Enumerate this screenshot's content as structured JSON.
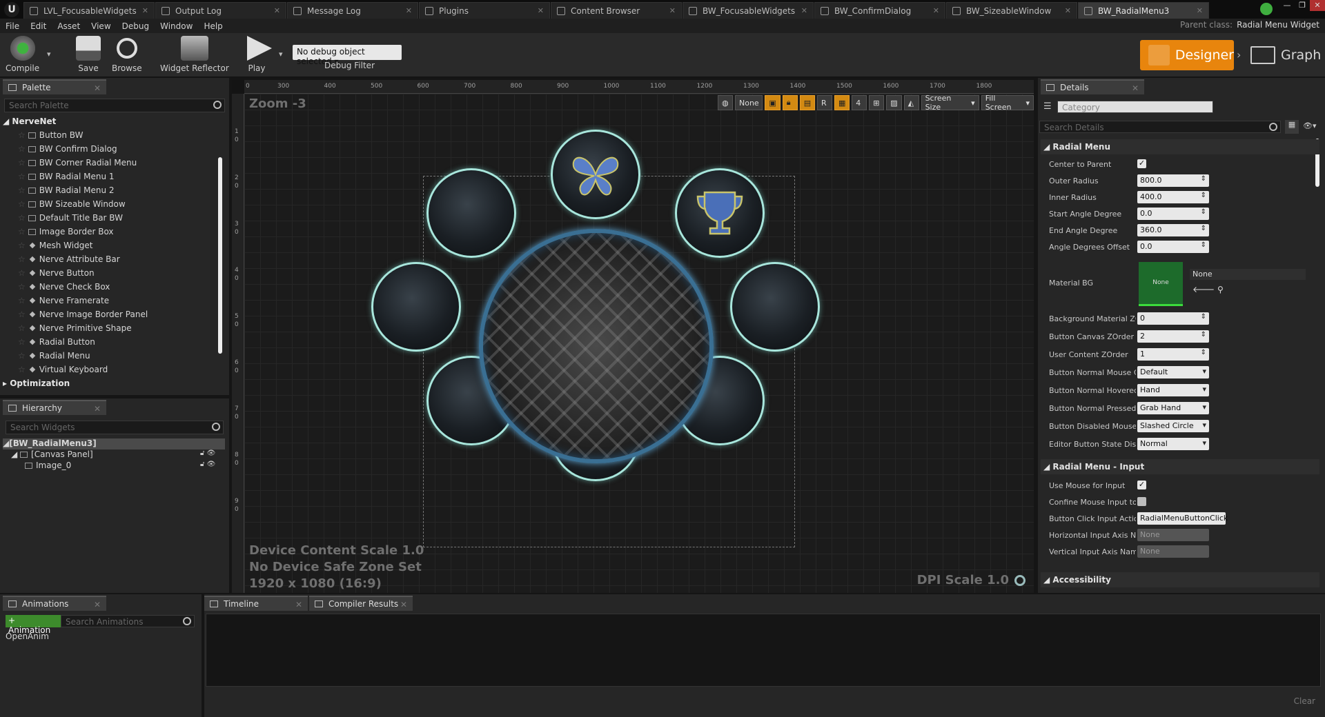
{
  "tabs": [
    {
      "label": "LVL_FocusableWidgets"
    },
    {
      "label": "Output Log"
    },
    {
      "label": "Message Log"
    },
    {
      "label": "Plugins"
    },
    {
      "label": "Content Browser"
    },
    {
      "label": "BW_FocusableWidgets"
    },
    {
      "label": "BW_ConfirmDialog"
    },
    {
      "label": "BW_SizeableWindow"
    },
    {
      "label": "BW_RadialMenu3"
    }
  ],
  "menu": [
    "File",
    "Edit",
    "Asset",
    "View",
    "Debug",
    "Window",
    "Help"
  ],
  "parent_class": {
    "label": "Parent class:",
    "value": "Radial Menu Widget"
  },
  "toolbar": {
    "compile": "Compile",
    "save": "Save",
    "browse": "Browse",
    "reflector": "Widget Reflector",
    "play": "Play",
    "debug_value": "No debug object selected",
    "debug_label": "Debug Filter",
    "designer": "Designer",
    "graph": "Graph"
  },
  "palette": {
    "title": "Palette",
    "search_placeholder": "Search Palette",
    "category": "NerveNet",
    "items": [
      "Button BW",
      "BW Confirm Dialog",
      "BW Corner Radial Menu",
      "BW Radial Menu 1",
      "BW Radial Menu 2",
      "BW Sizeable Window",
      "Default Title Bar BW",
      "Image Border Box",
      "Mesh Widget",
      "Nerve Attribute Bar",
      "Nerve Button",
      "Nerve Check Box",
      "Nerve Framerate",
      "Nerve Image Border Panel",
      "Nerve Primitive Shape",
      "Radial Button",
      "Radial Menu",
      "Virtual Keyboard"
    ],
    "category2": "Optimization"
  },
  "hierarchy": {
    "title": "Hierarchy",
    "search_placeholder": "Search Widgets",
    "root": "[BW_RadialMenu3]",
    "child": "[Canvas Panel]",
    "leaf": "Image_0"
  },
  "canvas": {
    "zoom": "Zoom -3",
    "ruler_top": [
      "0",
      "300",
      "400",
      "500",
      "600",
      "700",
      "800",
      "900",
      "1000",
      "1100",
      "1200",
      "1300",
      "1400",
      "1500",
      "1600",
      "1700",
      "1800"
    ],
    "ruler_left": [
      "1",
      "2",
      "3",
      "4",
      "5",
      "6",
      "7",
      "8",
      "9"
    ],
    "ruler_left_sub": [
      "0",
      "0",
      "0",
      "0",
      "0",
      "0",
      "0",
      "0",
      "0"
    ],
    "toolbar": {
      "none": "None",
      "r": "R",
      "four": "4",
      "screen_size": "Screen Size",
      "fill_screen": "Fill Screen"
    },
    "scale_text": "Device Content Scale 1.0",
    "safezone_text": "No Device Safe Zone Set",
    "resolution_text": "1920 x 1080 (16:9)",
    "dpi_text": "DPI Scale 1.0"
  },
  "details": {
    "title": "Details",
    "category_placeholder": "Category",
    "search_placeholder": "Search Details",
    "section1": "Radial Menu",
    "rows1": [
      {
        "label": "Center to Parent",
        "type": "check",
        "value": "✓"
      },
      {
        "label": "Outer Radius",
        "type": "num",
        "value": "800.0"
      },
      {
        "label": "Inner Radius",
        "type": "num",
        "value": "400.0"
      },
      {
        "label": "Start Angle Degree",
        "type": "num",
        "value": "0.0"
      },
      {
        "label": "End Angle Degree",
        "type": "num",
        "value": "360.0"
      },
      {
        "label": "Angle Degrees Offset",
        "type": "num",
        "value": "0.0"
      }
    ],
    "material_bg": {
      "label": "Material BG",
      "thumb": "None",
      "value": "None"
    },
    "rows2": [
      {
        "label": "Background Material ZO",
        "type": "num",
        "value": "0"
      },
      {
        "label": "Button Canvas ZOrder",
        "type": "num",
        "value": "2"
      },
      {
        "label": "User Content ZOrder",
        "type": "num",
        "value": "1"
      },
      {
        "label": "Button Normal Mouse Cu",
        "type": "dd",
        "value": "Default"
      },
      {
        "label": "Button Normal Hovered",
        "type": "dd",
        "value": "Hand"
      },
      {
        "label": "Button Normal Pressed M",
        "type": "dd",
        "value": "Grab Hand"
      },
      {
        "label": "Button Disabled Mouse C",
        "type": "dd",
        "value": "Slashed Circle"
      },
      {
        "label": "Editor Button State Displ",
        "type": "dd",
        "value": "Normal"
      }
    ],
    "section2": "Radial Menu - Input",
    "rows3": [
      {
        "label": "Use Mouse for Input",
        "type": "check",
        "value": "✓"
      },
      {
        "label": "Confine Mouse Input to R",
        "type": "check",
        "value": ""
      },
      {
        "label": "Button Click Input Action",
        "type": "text",
        "value": "RadialMenuButtonClick"
      },
      {
        "label": "Horizontal Input Axis Na",
        "type": "dis",
        "value": "None"
      },
      {
        "label": "Vertical Input Axis Name",
        "type": "dis",
        "value": "None"
      }
    ],
    "section3": "Accessibility"
  },
  "bottom": {
    "animations_title": "Animations",
    "add_animation": "+ Animation",
    "search_animations": "Search Animations",
    "anim_item": "OpenAnim",
    "timeline": "Timeline",
    "compiler": "Compiler Results",
    "clear": "Clear"
  },
  "colors": {
    "accent_orange": "#e8850d",
    "ring_teal": "#a8e6dc",
    "ring_blue": "#3a6f93",
    "butterfly_blue": "#5a7fc8",
    "trophy_blue": "#4a6fb8"
  }
}
